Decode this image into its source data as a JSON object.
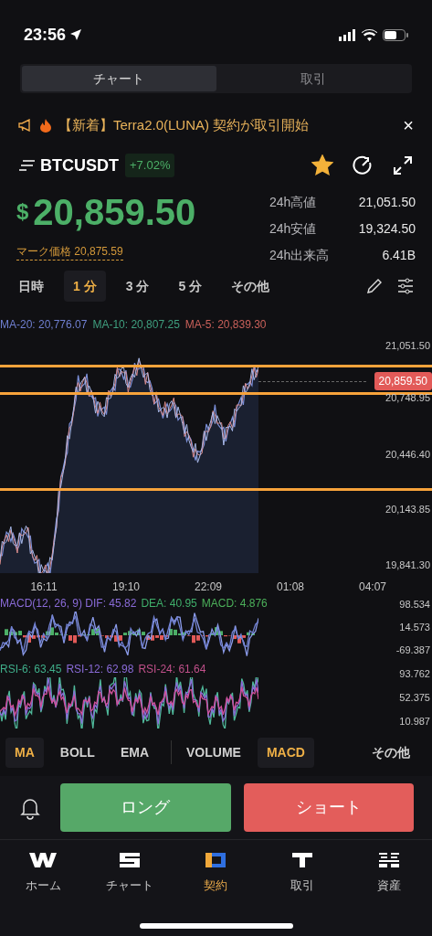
{
  "status_bar": {
    "time": "23:56"
  },
  "view_tabs": [
    {
      "label": "チャート",
      "selected": true
    },
    {
      "label": "取引",
      "selected": false
    }
  ],
  "announcement": {
    "text": "【新着】Terra2.0(LUNA) 契約が取引開始",
    "close": "×"
  },
  "symbol": {
    "name": "BTCUSDT",
    "change": "+7.02%",
    "favorite": true
  },
  "price": {
    "currency": "$",
    "value": "20,859.50",
    "mark_price": "マーク価格 20,875.59"
  },
  "stats": [
    {
      "label": "24h高値",
      "value": "21,051.50"
    },
    {
      "label": "24h安値",
      "value": "19,324.50"
    },
    {
      "label": "24h出来高",
      "value": "6.41B"
    }
  ],
  "intervals": [
    {
      "label": "日時",
      "selected": false
    },
    {
      "label": "1 分",
      "selected": true
    },
    {
      "label": "3 分",
      "selected": false
    },
    {
      "label": "5 分",
      "selected": false
    },
    {
      "label": "その他",
      "selected": false
    }
  ],
  "ma_legend": [
    {
      "text": "MA-20: 20,776.07",
      "color": "#6f7fd0"
    },
    {
      "text": "MA-10: 20,807.25",
      "color": "#3f9f7f"
    },
    {
      "text": "MA-5: 20,839.30",
      "color": "#c9605a"
    }
  ],
  "price_axis": [
    "21,051.50",
    "20,748.95",
    "20,446.40",
    "20,143.85",
    "19,841.30"
  ],
  "last_price_tag": "20,859.50",
  "time_axis": [
    "16:11",
    "19:10",
    "22:09",
    "01:08",
    "04:07"
  ],
  "macd_legend": [
    {
      "text": "MACD(12, 26, 9) DIF: 45.82",
      "color": "#8a6bd8"
    },
    {
      "text": "DEA: 40.95",
      "color": "#3fae6a"
    },
    {
      "text": "MACD: 4.876",
      "color": "#4cb05a"
    }
  ],
  "macd_axis": [
    "98.534",
    "14.573",
    "-69.387"
  ],
  "rsi_legend": [
    {
      "text": "RSI-6: 63.45",
      "color": "#3fae8a"
    },
    {
      "text": "RSI-12: 62.98",
      "color": "#8a6bd8"
    },
    {
      "text": "RSI-24: 61.64",
      "color": "#c0508a"
    }
  ],
  "rsi_axis": [
    "93.762",
    "52.375",
    "10.987"
  ],
  "indicator_tabs": [
    {
      "label": "MA",
      "selected": true
    },
    {
      "label": "BOLL",
      "selected": false
    },
    {
      "label": "EMA",
      "selected": false
    },
    {
      "label": "VOLUME",
      "selected": false
    },
    {
      "label": "MACD",
      "selected": true
    },
    {
      "label": "その他",
      "selected": false
    }
  ],
  "actions": {
    "long": "ロング",
    "short": "ショート"
  },
  "bottom_nav": [
    {
      "label": "ホーム",
      "selected": false
    },
    {
      "label": "チャート",
      "selected": false
    },
    {
      "label": "契約",
      "selected": true
    },
    {
      "label": "取引",
      "selected": false
    },
    {
      "label": "資産",
      "selected": false
    }
  ]
}
